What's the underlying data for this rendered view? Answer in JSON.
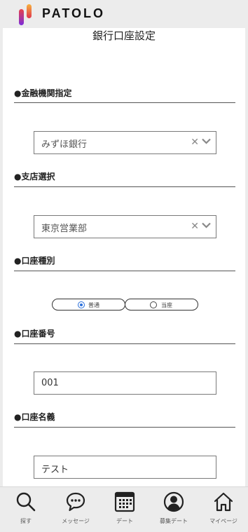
{
  "header": {
    "brand": "PATOLO"
  },
  "page": {
    "title": "銀行口座設定"
  },
  "bank": {
    "label": "●金融機関指定",
    "value": "みずほ銀行"
  },
  "branch": {
    "label": "●支店選択",
    "value": "東京営業部"
  },
  "account_type": {
    "label": "●口座種別",
    "options": [
      {
        "label": "普通",
        "selected": true
      },
      {
        "label": "当座",
        "selected": false
      }
    ]
  },
  "account_number": {
    "label": "●口座番号",
    "value": "001"
  },
  "account_name": {
    "label": "●口座名義",
    "value": "テスト"
  },
  "nav": {
    "items": [
      {
        "label": "探す",
        "icon": "search-icon"
      },
      {
        "label": "メッセージ",
        "icon": "chat-icon"
      },
      {
        "label": "デート",
        "icon": "calendar-icon"
      },
      {
        "label": "募集デート",
        "icon": "user-icon"
      },
      {
        "label": "マイページ",
        "icon": "home-icon"
      }
    ]
  },
  "colors": {
    "accent": "#2a6fdb",
    "logo_gradient": [
      "#f2a33a",
      "#e2374f",
      "#8a2be2"
    ]
  }
}
